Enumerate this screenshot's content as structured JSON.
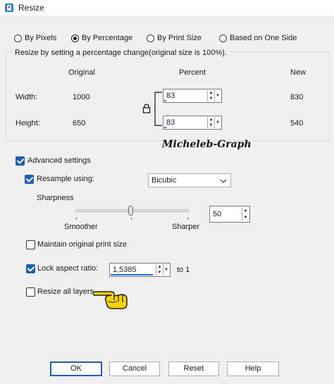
{
  "window": {
    "title": "Resize"
  },
  "modes": [
    {
      "label": "By Pixels",
      "checked": false
    },
    {
      "label": "By Percentage",
      "checked": true
    },
    {
      "label": "By Print Size",
      "checked": false
    },
    {
      "label": "Based on One Side",
      "checked": false
    }
  ],
  "group": {
    "legend": "Resize by setting a percentage change(original size is 100%).",
    "col_original": "Original",
    "col_percent": "Percent",
    "col_new": "New",
    "width_label": "Width:",
    "height_label": "Height:",
    "width_original": "1000",
    "height_original": "650",
    "width_percent": "83",
    "height_percent": "83",
    "width_new": "830",
    "height_new": "540"
  },
  "watermark": "Micheleb-Graph",
  "advanced": {
    "label": "Advanced settings",
    "checked": true
  },
  "resample": {
    "label": "Resample using:",
    "checked": true,
    "value": "Bicubic"
  },
  "sharpness": {
    "label": "Sharpness",
    "value": "50",
    "min_label": "Smoother",
    "max_label": "Sharper",
    "level": 0.5
  },
  "maintain": {
    "label": "Maintain original print size",
    "checked": false
  },
  "lock_ratio": {
    "label": "Lock aspect ratio:",
    "checked": true,
    "value": "1,5385",
    "suffix": "to 1"
  },
  "resize_layers": {
    "label": "Resize all layers",
    "checked": false
  },
  "buttons": {
    "ok": "OK",
    "cancel": "Cancel",
    "reset": "Reset",
    "help": "Help"
  },
  "icons": {
    "title": "app-icon",
    "lock": "lock-icon",
    "pointer": "pointing-hand-icon"
  },
  "colors": {
    "accent": "#1d5fb4",
    "pointer": "#f3d20f"
  }
}
